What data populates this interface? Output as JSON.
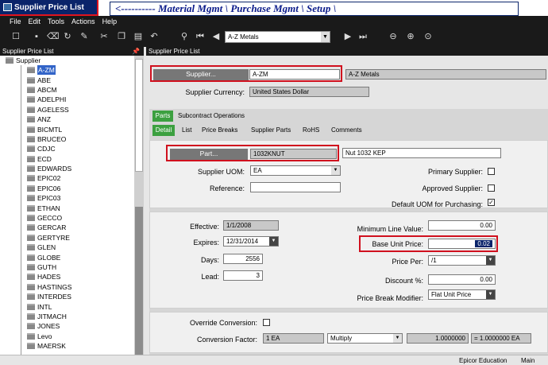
{
  "window": {
    "title": "Supplier Price List"
  },
  "banner": {
    "text": "<---------- Material Mgmt \\ Purchase Mgmt \\ Setup \\"
  },
  "menu": {
    "items": [
      "File",
      "Edit",
      "Tools",
      "Actions",
      "Help"
    ]
  },
  "toolbar": {
    "icons": [
      "new-icon",
      "save-icon",
      "clear-icon",
      "refresh-icon",
      "attach-icon",
      "cut-icon",
      "copy-icon",
      "paste-icon",
      "undo-icon",
      "binoculars-icon",
      "first-icon",
      "prev-icon",
      "next-icon",
      "last-icon",
      "back-icon",
      "forward-icon",
      "home-icon"
    ],
    "navigator_value": "A-Z Metals"
  },
  "left_panel": {
    "header": "Supplier Price List",
    "root": "Supplier",
    "suppliers": [
      "A-ZM",
      "ABE",
      "ABCM",
      "ADELPHI",
      "AGELESS",
      "ANZ",
      "BICMTL",
      "BRUCEO",
      "CDJC",
      "ECD",
      "EDWARDS",
      "EPIC02",
      "EPIC06",
      "EPIC03",
      "ETHAN",
      "GECCO",
      "GERCAR",
      "GERTYRE",
      "GLEN",
      "GLOBE",
      "GUTH",
      "HADES",
      "HASTINGS",
      "INTERDES",
      "INTL",
      "JITMACH",
      "JONES",
      "Levo",
      "MAERSK"
    ],
    "selected": "A-ZM"
  },
  "right_panel": {
    "header": "Supplier Price List",
    "supplier_button": "Supplier...",
    "supplier_id": "A-ZM",
    "supplier_name": "A-Z Metals",
    "currency_label": "Supplier Currency:",
    "currency_value": "United States Dollar",
    "main_tabs": [
      "Parts",
      "Subcontract Operations"
    ],
    "sub_tabs": [
      "Detail",
      "List",
      "Price Breaks",
      "Supplier Parts",
      "RoHS",
      "Comments"
    ],
    "part_button": "Part...",
    "part_num": "1032KNUT",
    "part_desc": "Nut 1032 KEP",
    "uom_label": "Supplier UOM:",
    "uom_value": "EA",
    "reference_label": "Reference:",
    "reference_value": "",
    "primary_label": "Primary Supplier:",
    "approved_label": "Approved Supplier:",
    "default_uom_label": "Default UOM for Purchasing:",
    "primary_checked": false,
    "approved_checked": false,
    "default_uom_checked": true,
    "effective_label": "Effective:",
    "effective_value": "1/1/2008",
    "expires_label": "Expires:",
    "expires_value": "12/31/2014",
    "days_label": "Days:",
    "days_value": "2556",
    "lead_label": "Lead:",
    "lead_value": "3",
    "min_line_label": "Minimum Line Value:",
    "min_line_value": "0.00",
    "base_price_label": "Base Unit Price:",
    "base_price_value": "0.02",
    "price_per_label": "Price Per:",
    "price_per_value": "/1",
    "discount_label": "Discount %:",
    "discount_value": "0.00",
    "modifier_label": "Price Break Modifier:",
    "modifier_value": "Flat Unit Price",
    "override_label": "Override Conversion:",
    "conversion_label": "Conversion Factor:",
    "conv_uom": "1 EA",
    "conv_op": "Multiply",
    "conv_factor": "1.0000000",
    "conv_result": "= 1.0000000 EA"
  },
  "status": {
    "company": "Epicor Education",
    "site": "Main"
  },
  "colors": {
    "highlight_red": "#d0101e",
    "tab_green": "#3ca040",
    "title_blue": "#0a246a",
    "selected_blue": "#3264c8"
  }
}
